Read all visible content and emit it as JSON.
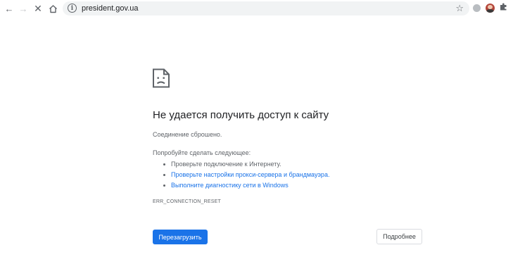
{
  "browser": {
    "url": "president.gov.ua",
    "icons": {
      "back": "back-arrow-icon",
      "forward": "forward-arrow-icon",
      "stop": "close-icon",
      "home": "home-icon",
      "info": "info-icon",
      "bookmark": "star-icon",
      "extension": "extension-icon",
      "profile": "avatar",
      "extensions_menu": "puzzle-icon"
    }
  },
  "error_page": {
    "icon": "sad-page-icon",
    "title": "Не удается получить доступ к сайту",
    "subtitle": "Соединение сброшено.",
    "try_heading": "Попробуйте сделать следующее:",
    "suggestions": [
      {
        "label": "Проверьте подключение к Интернету.",
        "is_link": false
      },
      {
        "label": "Проверьте настройки прокси-сервера и брандмауэра.",
        "is_link": true
      },
      {
        "label": "Выполните диагностику сети в Windows",
        "is_link": true
      }
    ],
    "error_code": "ERR_CONNECTION_RESET",
    "reload_label": "Перезагрузить",
    "details_label": "Подробнее"
  },
  "colors": {
    "accent": "#1a73e8",
    "text": "#202124",
    "secondary_text": "#5f6368",
    "omnibox_bg": "#f1f3f4"
  }
}
